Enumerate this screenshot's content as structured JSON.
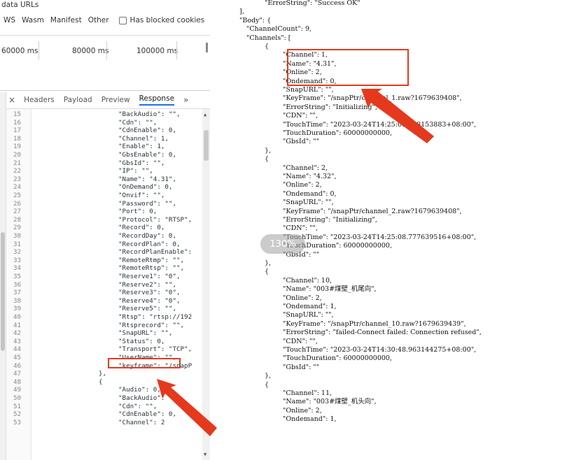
{
  "devtools": {
    "top_text": "data URLs",
    "filters": [
      "WS",
      "Wasm",
      "Manifest",
      "Other"
    ],
    "checkbox_label": "Has blocked cookies",
    "timeline_labels": [
      "60000 ms",
      "80000 ms",
      "100000 ms"
    ],
    "tabs": [
      "Headers",
      "Payload",
      "Preview",
      "Response"
    ],
    "active_tab": "Response",
    "close_glyph": "×",
    "more_glyph": "»",
    "scroll_up_glyph": "▲",
    "scroll_down_glyph": "▼",
    "response_lines": [
      {
        "n": "15",
        "t": "\"BackAudio\": \"\","
      },
      {
        "n": "16",
        "t": "\"Cdn\": \"\","
      },
      {
        "n": "17",
        "t": "\"CdnEnable\": 0,"
      },
      {
        "n": "18",
        "t": "\"Channel\": 1,"
      },
      {
        "n": "19",
        "t": "\"Enable\": 1,"
      },
      {
        "n": "20",
        "t": "\"GbsEnable\": 0,"
      },
      {
        "n": "21",
        "t": "\"GbsId\": \"\","
      },
      {
        "n": "22",
        "t": "\"IP\": \"\","
      },
      {
        "n": "23",
        "t": "\"Name\": \"4.31\","
      },
      {
        "n": "24",
        "t": "\"OnDemand\": 0,"
      },
      {
        "n": "25",
        "t": "\"Onvif\": \"\","
      },
      {
        "n": "26",
        "t": "\"Password\": \"\","
      },
      {
        "n": "27",
        "t": "\"Port\": 0,"
      },
      {
        "n": "28",
        "t": "\"Protocol\": \"RTSP\","
      },
      {
        "n": "29",
        "t": "\"Record\": 0,"
      },
      {
        "n": "30",
        "t": "\"RecordDay\": 0,"
      },
      {
        "n": "31",
        "t": "\"RecordPlan\": 0,"
      },
      {
        "n": "32",
        "t": "\"RecordPlanEnable\":"
      },
      {
        "n": "33",
        "t": "\"RemoteRtmp\": \"\","
      },
      {
        "n": "34",
        "t": "\"RemoteRtsp\": \"\","
      },
      {
        "n": "35",
        "t": "\"Reserve1\": \"0\","
      },
      {
        "n": "36",
        "t": "\"Reserve2\": \"\","
      },
      {
        "n": "37",
        "t": "\"Reserve3\": \"0\","
      },
      {
        "n": "38",
        "t": "\"Reserve4\": \"0\","
      },
      {
        "n": "39",
        "t": "\"Reserve5\": \"\","
      },
      {
        "n": "40",
        "t": "\"Rtsp\": \"rtsp://192"
      },
      {
        "n": "41",
        "t": "\"Rtsprecord\": \"\","
      },
      {
        "n": "42",
        "t": "\"SnapURL\": \"\","
      },
      {
        "n": "43",
        "t": "\"Status\": 0,"
      },
      {
        "n": "44",
        "t": "\"Transport\": \"TCP\","
      },
      {
        "n": "45",
        "t": "\"UserName\": \"\","
      },
      {
        "n": "46",
        "t": "\"keyframe\": \"/snapP"
      },
      {
        "n": "47",
        "t": "},"
      },
      {
        "n": "48",
        "t": "{"
      },
      {
        "n": "49",
        "t": "\"Audio\": 0,"
      },
      {
        "n": "50",
        "t": "\"BackAudio\": \"\","
      },
      {
        "n": "51",
        "t": "\"Cdn\": \"\","
      },
      {
        "n": "52",
        "t": "\"CdnEnable\": 0,"
      },
      {
        "n": "53",
        "t": "\"Channel\": 2"
      }
    ]
  },
  "json_view": {
    "lines": [
      "\"ErrorString\": \"Success OK\"",
      "],",
      "\"Body\": {",
      "\"ChannelCount\": 9,",
      "\"Channels\": [",
      "{",
      "\"Channel\": 1,",
      "\"Name\": \"4.31\",",
      "\"Online\": 2,",
      "\"Ondemand\": 0,",
      "\"SnapURL\": \"\",",
      "\"KeyFrame\": \"/snapPtr/channel_1.raw?1679639408\",",
      "\"ErrorString\": \"Initializing\",",
      "\"CDN\": \"\",",
      "\"TouchTime\": \"2023-03-24T14:25:08.778153883+08:00\",",
      "\"TouchDuration\": 60000000000,",
      "\"GbsId\": \"\"",
      "},",
      "{",
      "\"Channel\": 2,",
      "\"Name\": \"4.32\",",
      "\"Online\": 2,",
      "\"Ondemand\": 0,",
      "\"SnapURL\": \"\",",
      "\"KeyFrame\": \"/snapPtr/channel_2.raw?1679639408\",",
      "\"ErrorString\": \"Initializing\",",
      "\"CDN\": \"\",",
      "\"TouchTime\": \"2023-03-24T14:25:08.777639516+08:00\",",
      "\"TouchDuration\": 60000000000,",
      "\"GbsId\": \"\"",
      "},",
      "{",
      "\"Channel\": 10,",
      "\"Name\": \"003#煤壁_机尾向\",",
      "\"Online\": 2,",
      "\"Ondemand\": 1,",
      "\"SnapURL\": \"\",",
      "\"KeyFrame\": \"/snapPtr/channel_10.raw?1679639439\",",
      "\"ErrorString\": \"failed-Connect failed: Connection refused\",",
      "\"CDN\": \"\",",
      "\"TouchTime\": \"2023-03-24T14:30:48.963144275+08:00\",",
      "\"TouchDuration\": 60000000000,",
      "\"GbsId\": \"\"",
      "},",
      "{",
      "\"Channel\": 11,",
      "\"Name\": \"003#煤壁_机头向\",",
      "\"Online\": 2,",
      "\"Ondemand\": 1,"
    ]
  },
  "overlay": {
    "zoom_text": "130%",
    "highlight_color": "#e23b1f"
  }
}
